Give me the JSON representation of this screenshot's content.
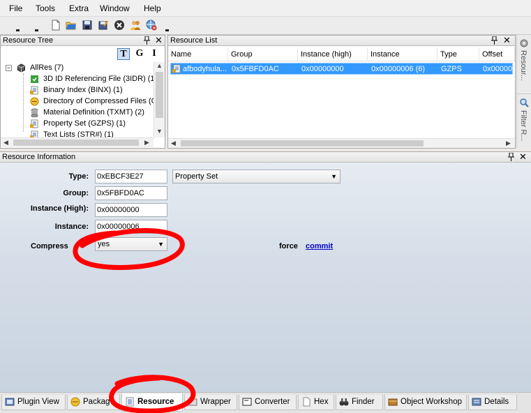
{
  "menu": [
    "File",
    "Tools",
    "Extra",
    "Window",
    "Help"
  ],
  "resource_tree": {
    "title": "Resource Tree",
    "filter_buttons": [
      "T",
      "G",
      "I"
    ],
    "root": "AllRes (7)",
    "items": [
      "3D ID Referencing File (3IDR) (1)",
      "Binary Index (BINX) (1)",
      "Directory of Compressed Files (C",
      "Material Definition (TXMT) (2)",
      "Property Set (GZPS) (1)",
      "Text Lists (STR#) (1)"
    ]
  },
  "resource_list": {
    "title": "Resource List",
    "columns": [
      "Name",
      "Group",
      "Instance (high)",
      "Instance",
      "Type",
      "Offset"
    ],
    "rows": [
      [
        "afbodyhula...",
        "0x5FBFD0AC",
        "0x00000000",
        "0x00000006 (6)",
        "GZPS",
        "0x00000"
      ]
    ]
  },
  "side_panels": [
    "Resour...",
    "Filter R..."
  ],
  "resource_info": {
    "title": "Resource Information",
    "type_label": "Type:",
    "type_value": "0xEBCF3E27",
    "type_name": "Property Set",
    "group_label": "Group:",
    "group_value": "0x5FBFD0AC",
    "instance_high_label": "Instance (High):",
    "instance_high_value": "0x00000000",
    "instance_label": "Instance:",
    "instance_value": "0x00000006",
    "compressed_label": "Compress",
    "compressed_value": "yes",
    "force_label": "force",
    "commit_link": "commit"
  },
  "tabs": [
    "Plugin View",
    "Packag",
    "Resource",
    "Wrapper",
    "Converter",
    "Hex",
    "Finder",
    "Object Workshop",
    "Details"
  ],
  "colors": {
    "selection": "#3399ff",
    "annotation": "#ff0000",
    "link": "#0000cc"
  },
  "icons": {
    "toolbar": [
      "new-file-icon",
      "open-folder-icon",
      "save-icon",
      "save-as-icon",
      "close-icon",
      "users-icon",
      "web-icon"
    ]
  }
}
